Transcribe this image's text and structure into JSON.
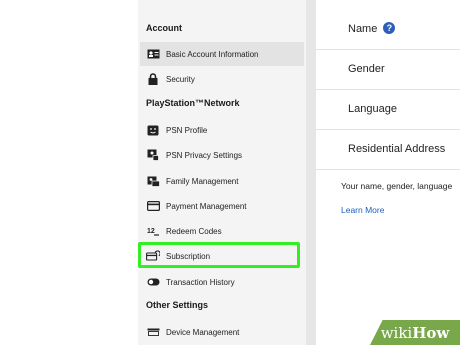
{
  "sidebar": {
    "sections": [
      {
        "title": "Account"
      },
      {
        "title": "PlayStation™Network"
      },
      {
        "title": "Other Settings"
      }
    ],
    "account_items": [
      {
        "label": "Basic Account Information",
        "icon": "id-card-icon",
        "active": true
      },
      {
        "label": "Security",
        "icon": "lock-icon"
      }
    ],
    "psn_items": [
      {
        "label": "PSN Profile",
        "icon": "profile-face-icon"
      },
      {
        "label": "PSN Privacy Settings",
        "icon": "privacy-icon"
      },
      {
        "label": "Family Management",
        "icon": "family-icon"
      },
      {
        "label": "Payment Management",
        "icon": "credit-card-icon"
      },
      {
        "label": "Redeem Codes",
        "icon": "code-icon"
      },
      {
        "label": "Subscription",
        "icon": "subscription-icon",
        "highlighted": true
      },
      {
        "label": "Transaction History",
        "icon": "toggle-icon"
      }
    ],
    "other_items": [
      {
        "label": "Device Management",
        "icon": "device-icon"
      }
    ]
  },
  "main": {
    "fields": [
      {
        "label": "Name"
      },
      {
        "label": "Gender"
      },
      {
        "label": "Language"
      },
      {
        "label": "Residential Address"
      }
    ],
    "help_glyph": "?",
    "description": "Your name, gender, language",
    "learn_more": "Learn More"
  },
  "watermark": {
    "prefix": "wiki",
    "suffix": "How"
  },
  "colors": {
    "highlight": "#33ee22",
    "link": "#1f5fb8",
    "help_badge": "#2e5fb8",
    "watermark_bg": "#79a84b"
  }
}
